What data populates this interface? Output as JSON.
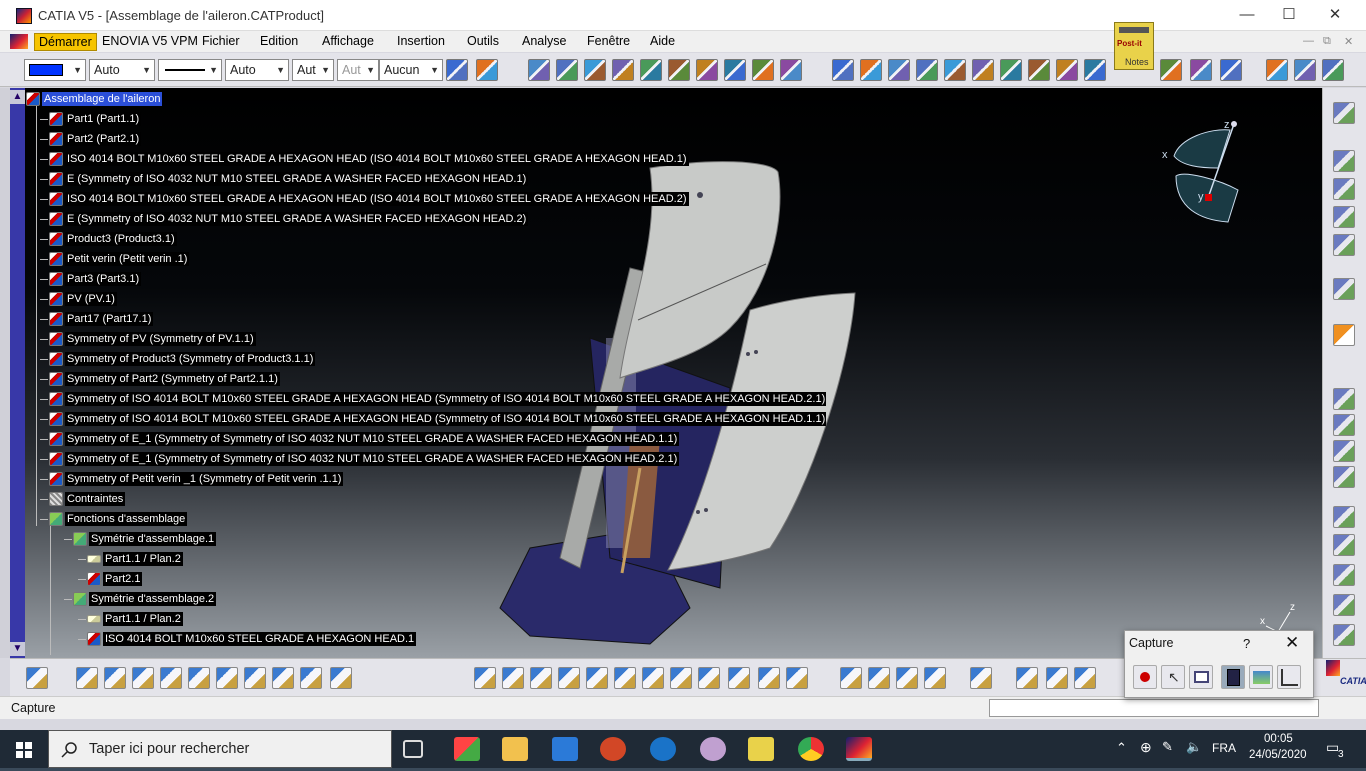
{
  "window": {
    "title": "CATIA V5 - [Assemblage de l'aileron.CATProduct]",
    "min_glyph": "—",
    "max_glyph": "☐",
    "close_glyph": "✕"
  },
  "menubar": {
    "items": [
      "Démarrer",
      "ENOVIA V5 VPM",
      "Fichier",
      "Edition",
      "Affichage",
      "Insertion",
      "Outils",
      "Analyse",
      "Fenêtre",
      "Aide"
    ],
    "active_item": "Démarrer",
    "mdi_min": "—",
    "mdi_restore": "⧉",
    "mdi_close": "✕"
  },
  "postit": {
    "label1": "Post-it",
    "label2": "Notes"
  },
  "toolbar1": {
    "color_value": "",
    "line_type1": "Auto",
    "line_weight1": "Auto",
    "line_type2": "Aut",
    "line_type3": "Aut",
    "layer": "Aucun",
    "accent_color": "#0033ff"
  },
  "tree": {
    "nodes": [
      {
        "label": "Assemblage de l'aileron",
        "level": 0,
        "icon": "product-icon",
        "selected": true
      },
      {
        "label": "Part1 (Part1.1)",
        "level": 1,
        "icon": "part-icon"
      },
      {
        "label": "Part2 (Part2.1)",
        "level": 1,
        "icon": "part-icon"
      },
      {
        "label": "ISO 4014 BOLT M10x60 STEEL GRADE A HEXAGON HEAD (ISO 4014 BOLT M10x60 STEEL GRADE A HEXAGON HEAD.1)",
        "level": 1,
        "icon": "part-icon"
      },
      {
        "label": "E (Symmetry of ISO 4032 NUT M10 STEEL GRADE A WASHER FACED HEXAGON HEAD.1)",
        "level": 1,
        "icon": "part-icon"
      },
      {
        "label": "ISO 4014 BOLT M10x60 STEEL GRADE A HEXAGON HEAD (ISO 4014 BOLT M10x60 STEEL GRADE A HEXAGON HEAD.2)",
        "level": 1,
        "icon": "part-icon"
      },
      {
        "label": "E (Symmetry of ISO 4032 NUT M10 STEEL GRADE A WASHER FACED HEXAGON HEAD.2)",
        "level": 1,
        "icon": "part-icon"
      },
      {
        "label": "Product3 (Product3.1)",
        "level": 1,
        "icon": "product-icon"
      },
      {
        "label": "Petit verin  (Petit verin .1)",
        "level": 1,
        "icon": "product-icon"
      },
      {
        "label": "Part3 (Part3.1)",
        "level": 1,
        "icon": "part-icon"
      },
      {
        "label": "PV (PV.1)",
        "level": 1,
        "icon": "product-icon"
      },
      {
        "label": "Part17 (Part17.1)",
        "level": 1,
        "icon": "part-icon"
      },
      {
        "label": "Symmetry of PV (Symmetry of PV.1.1)",
        "level": 1,
        "icon": "product-icon"
      },
      {
        "label": "Symmetry of Product3 (Symmetry of Product3.1.1)",
        "level": 1,
        "icon": "product-icon"
      },
      {
        "label": "Symmetry of Part2 (Symmetry of Part2.1.1)",
        "level": 1,
        "icon": "part-icon"
      },
      {
        "label": "Symmetry of ISO 4014 BOLT M10x60 STEEL GRADE A HEXAGON HEAD (Symmetry of ISO 4014 BOLT M10x60 STEEL GRADE A HEXAGON HEAD.2.1)",
        "level": 1,
        "icon": "part-icon"
      },
      {
        "label": "Symmetry of ISO 4014 BOLT M10x60 STEEL GRADE A HEXAGON HEAD (Symmetry of ISO 4014 BOLT M10x60 STEEL GRADE A HEXAGON HEAD.1.1)",
        "level": 1,
        "icon": "part-icon"
      },
      {
        "label": "Symmetry of E_1 (Symmetry of Symmetry of ISO 4032 NUT M10 STEEL GRADE A WASHER FACED HEXAGON HEAD.1.1)",
        "level": 1,
        "icon": "part-icon"
      },
      {
        "label": "Symmetry of E_1 (Symmetry of Symmetry of ISO 4032 NUT M10 STEEL GRADE A WASHER FACED HEXAGON HEAD.2.1)",
        "level": 1,
        "icon": "part-icon"
      },
      {
        "label": "Symmetry of Petit verin _1 (Symmetry of Petit verin .1.1)",
        "level": 1,
        "icon": "product-icon"
      },
      {
        "label": "Contraintes",
        "level": 1,
        "icon": "constraints-icon"
      },
      {
        "label": "Fonctions d'assemblage",
        "level": 1,
        "icon": "assembly-features-icon"
      },
      {
        "label": "Symétrie d'assemblage.1",
        "level": 2,
        "icon": "symmetry-icon"
      },
      {
        "label": "Part1.1 / Plan.2",
        "level": 3,
        "icon": "plane-icon"
      },
      {
        "label": "Part2.1",
        "level": 3,
        "icon": "part-icon"
      },
      {
        "label": "Symétrie d'assemblage.2",
        "level": 2,
        "icon": "symmetry-icon"
      },
      {
        "label": "Part1.1 / Plan.2",
        "level": 3,
        "icon": "plane-icon"
      },
      {
        "label": "ISO 4014 BOLT M10x60 STEEL GRADE A HEXAGON HEAD.1",
        "level": 3,
        "icon": "part-icon"
      }
    ]
  },
  "compass": {
    "x": "x",
    "y": "y",
    "z": "z"
  },
  "axis_triad": {
    "x": "x",
    "y": "y",
    "z": "z"
  },
  "capture_panel": {
    "title": "Capture",
    "help": "?",
    "close": "✕"
  },
  "statusbar": {
    "text": "Capture"
  },
  "taskbar": {
    "search_placeholder": "Taper ici pour rechercher",
    "language": "FRA",
    "time": "00:05",
    "date": "24/05/2020",
    "notification_count": "3"
  },
  "catia_logo": "CATIA"
}
